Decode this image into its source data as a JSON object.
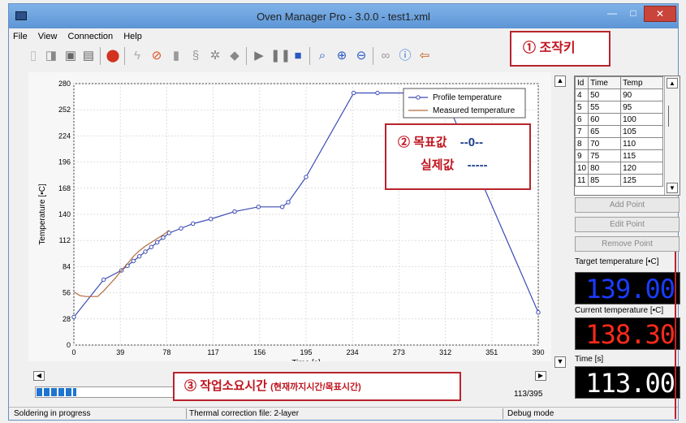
{
  "window": {
    "title": "Oven Manager Pro - 3.0.0 - test1.xml",
    "min_glyph": "—",
    "max_glyph": "□",
    "close_glyph": "✕"
  },
  "menu": [
    "File",
    "View",
    "Connection",
    "Help"
  ],
  "toolbar": {
    "icons": [
      "new-icon",
      "open-icon",
      "save-icon",
      "save-as-icon",
      "marker-icon",
      "lightning-icon",
      "stop-sign-icon",
      "device-icon",
      "steam-icon",
      "fan-icon",
      "heater-icon",
      "play-icon",
      "pause-icon",
      "stop-icon",
      "zoom-fit-icon",
      "zoom-in-icon",
      "zoom-out-icon",
      "link-icon",
      "info-icon",
      "exit-icon"
    ]
  },
  "annotations": {
    "toolbar_keys": {
      "number": "①",
      "label": "조작키"
    },
    "values": {
      "number": "②",
      "target_label": "목표값",
      "target_value": "--0--",
      "actual_label": "실제값",
      "actual_value": "-----"
    },
    "elapsed": {
      "number": "③",
      "label": "작업소요시간",
      "note": "(현재까지시간/목표시간)"
    }
  },
  "chart_data": {
    "type": "line",
    "xlabel": "Time [s]",
    "ylabel": "Temperature [•C]",
    "xlim": [
      0,
      390
    ],
    "ylim": [
      0,
      280
    ],
    "xticks": [
      0,
      39,
      78,
      117,
      156,
      195,
      234,
      273,
      312,
      351,
      390
    ],
    "yticks": [
      0,
      28,
      56,
      84,
      112,
      140,
      168,
      196,
      224,
      252,
      280
    ],
    "legend_position": "top-right",
    "series": [
      {
        "name": "Profile temperature",
        "color": "#3b4bb5",
        "x": [
          0,
          25,
          40,
          45,
          50,
          55,
          60,
          65,
          70,
          75,
          80,
          90,
          100,
          115,
          135,
          155,
          175,
          180,
          195,
          235,
          255,
          310,
          390
        ],
        "y": [
          30,
          70,
          80,
          85,
          90,
          95,
          100,
          105,
          110,
          115,
          120,
          125,
          130,
          135,
          143,
          148,
          148,
          153,
          180,
          270,
          270,
          270,
          35
        ]
      },
      {
        "name": "Measured temperature",
        "color": "#b36a3c",
        "x": [
          0,
          5,
          10,
          15,
          20,
          25,
          30,
          35,
          40,
          45,
          50,
          55,
          60,
          65,
          70,
          75,
          80
        ],
        "y": [
          57,
          53,
          52,
          52,
          52,
          58,
          65,
          72,
          80,
          87,
          95,
          101,
          106,
          110,
          114,
          118,
          123
        ]
      }
    ]
  },
  "points_table": {
    "columns": [
      "Id",
      "Time",
      "Temp"
    ],
    "rows": [
      [
        "4",
        "50",
        "90"
      ],
      [
        "5",
        "55",
        "95"
      ],
      [
        "6",
        "60",
        "100"
      ],
      [
        "7",
        "65",
        "105"
      ],
      [
        "8",
        "70",
        "110"
      ],
      [
        "9",
        "75",
        "115"
      ],
      [
        "10",
        "80",
        "120"
      ],
      [
        "11",
        "85",
        "125"
      ]
    ]
  },
  "buttons": {
    "add_point": "Add Point",
    "edit_point": "Edit Point",
    "remove_point": "Remove Point"
  },
  "displays": {
    "target_label": "Target temperature [•C]",
    "target_value": "139.00",
    "current_label": "Current temperature [•C]",
    "current_value": "138.30",
    "time_label": "Time [s]",
    "time_value": "113.00"
  },
  "progress": {
    "text": "113/395",
    "fraction": 0.286
  },
  "status": {
    "left": "Soldering in progress",
    "middle": "Thermal correction file: 2-layer",
    "right": "Debug mode"
  }
}
